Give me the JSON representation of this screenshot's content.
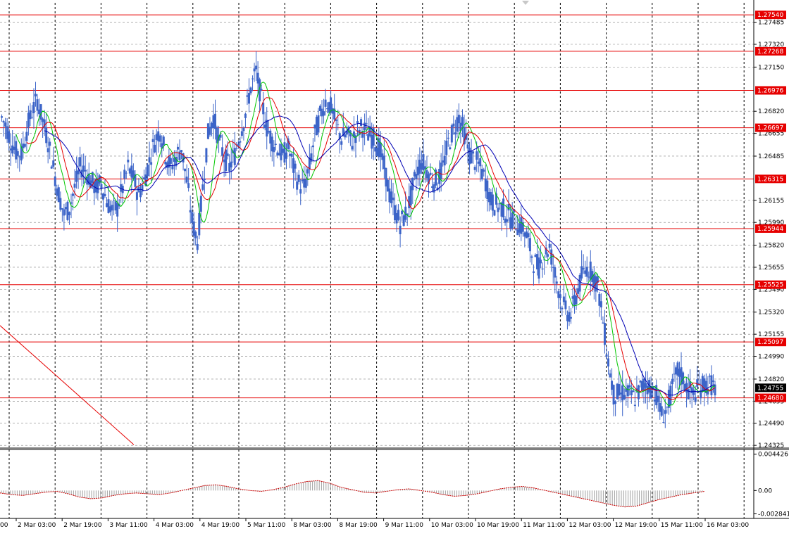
{
  "chart_data": {
    "type": "candlestick",
    "instrument_note": "",
    "y_axis": {
      "ylim": [
        1.2431,
        1.2763
      ],
      "tick_labels": [
        "1.27485",
        "1.27320",
        "1.27150",
        "1.26820",
        "1.26655",
        "1.26485",
        "1.26155",
        "1.25990",
        "1.25820",
        "1.25655",
        "1.25490",
        "1.25320",
        "1.25155",
        "1.24990",
        "1.24820",
        "1.24655",
        "1.24490",
        "1.24325"
      ],
      "tick_values": [
        1.27485,
        1.2732,
        1.2715,
        1.2682,
        1.26655,
        1.26485,
        1.26155,
        1.2599,
        1.2582,
        1.25655,
        1.2549,
        1.2532,
        1.25155,
        1.2499,
        1.2482,
        1.24655,
        1.2449,
        1.24325
      ]
    },
    "x_axis": {
      "tick_labels": [
        "2 Mar 03:00",
        "2 Mar 19:00",
        "3 Mar 11:00",
        "4 Mar 03:00",
        "4 Mar 19:00",
        "5 Mar 11:00",
        "8 Mar 03:00",
        "8 Mar 19:00",
        "9 Mar 11:00",
        "10 Mar 03:00",
        "10 Mar 19:00",
        "11 Mar 11:00",
        "12 Mar 03:00",
        "12 Mar 19:00",
        "15 Mar 11:00",
        "16 Mar 03:00"
      ],
      "left_edge_label": "00"
    },
    "horizontal_levels": [
      {
        "value": 1.2754,
        "label": "1.27540"
      },
      {
        "value": 1.27268,
        "label": "1.27268"
      },
      {
        "value": 1.26976,
        "label": "1.26976"
      },
      {
        "value": 1.26697,
        "label": "1.26697"
      },
      {
        "value": 1.26315,
        "label": "1.26315"
      },
      {
        "value": 1.25944,
        "label": "1.25944"
      },
      {
        "value": 1.25525,
        "label": "1.25525"
      },
      {
        "value": 1.25097,
        "label": "1.25097"
      },
      {
        "value": 1.2468,
        "label": "1.24680"
      }
    ],
    "current_price": {
      "value": 1.24755,
      "label": "1.24755"
    },
    "trend_line": {
      "from_value": 1.2522,
      "to_value": 1.2433
    },
    "price_path": [
      1.268,
      1.2672,
      1.266,
      1.2652,
      1.265,
      1.2668,
      1.2682,
      1.269,
      1.2675,
      1.266,
      1.264,
      1.262,
      1.2605,
      1.261,
      1.2625,
      1.264,
      1.2638,
      1.263,
      1.2625,
      1.2628,
      1.2615,
      1.2608,
      1.261,
      1.2625,
      1.264,
      1.2632,
      1.262,
      1.263,
      1.2645,
      1.266,
      1.2668,
      1.265,
      1.264,
      1.2648,
      1.2655,
      1.263,
      1.26,
      1.2585,
      1.2625,
      1.2665,
      1.2678,
      1.266,
      1.2648,
      1.264,
      1.265,
      1.2665,
      1.268,
      1.27,
      1.2712,
      1.269,
      1.267,
      1.266,
      1.2655,
      1.2648,
      1.2655,
      1.264,
      1.2628,
      1.2625,
      1.264,
      1.2665,
      1.2678,
      1.269,
      1.2685,
      1.2672,
      1.2662,
      1.2665,
      1.266,
      1.2668,
      1.267,
      1.2665,
      1.2662,
      1.2655,
      1.264,
      1.262,
      1.2608,
      1.2598,
      1.2605,
      1.2618,
      1.2635,
      1.2645,
      1.2638,
      1.263,
      1.263,
      1.264,
      1.2658,
      1.2668,
      1.2678,
      1.2665,
      1.265,
      1.2645,
      1.264,
      1.263,
      1.2615,
      1.2612,
      1.261,
      1.2605,
      1.2602,
      1.2598,
      1.2595,
      1.2585,
      1.257,
      1.2565,
      1.2575,
      1.258,
      1.256,
      1.2545,
      1.2532,
      1.253,
      1.2545,
      1.2558,
      1.2565,
      1.2562,
      1.2552,
      1.2525,
      1.2495,
      1.247,
      1.247,
      1.2472,
      1.247,
      1.2468,
      1.2475,
      1.2478,
      1.2476,
      1.247,
      1.2455,
      1.246,
      1.2475,
      1.2488,
      1.2482,
      1.2474,
      1.247,
      1.2476,
      1.2478,
      1.2478,
      1.24755
    ],
    "oscillator": {
      "tick_labels": [
        "0.004426",
        "0.00",
        "-0.002841"
      ],
      "tick_values": [
        0.004426,
        0,
        -0.002841
      ],
      "ylim": [
        -0.0034,
        0.005
      ],
      "signal_path": [
        -0.0003,
        -0.0005,
        -0.0006,
        -0.0004,
        -0.0002,
        -0.0001,
        -0.0004,
        -0.0008,
        -0.001,
        -0.0009,
        -0.0006,
        -0.0004,
        -0.0003,
        -0.0004,
        -0.0005,
        -0.0003,
        0.0,
        0.0003,
        0.0006,
        0.0007,
        0.0005,
        0.0002,
        0.0,
        -0.0001,
        0.0001,
        0.0004,
        0.0008,
        0.0011,
        0.0012,
        0.0009,
        0.0004,
        0.0001,
        -0.0002,
        -0.0003,
        -0.0001,
        0.0001,
        0.0002,
        0.0,
        -0.0002,
        -0.0005,
        -0.0007,
        -0.0006,
        -0.0004,
        -0.0001,
        0.0002,
        0.0004,
        0.0005,
        0.0003,
        0.0,
        -0.0003,
        -0.0006,
        -0.0009,
        -0.0012,
        -0.0015,
        -0.0018,
        -0.002,
        -0.0019,
        -0.0015,
        -0.0011,
        -0.0008,
        -0.0005,
        -0.0003,
        -0.0001
      ]
    },
    "series": [],
    "colors": {
      "candle": "#3c64c8",
      "level": "#e60000",
      "ma_fast": "#00c800",
      "ma_mid": "#e60000",
      "ma_slow": "#0000b4",
      "grid": "#808080",
      "price_tag": "#000000",
      "oscillator_signal": "#c80000",
      "oscillator_hist": "#a0a0a0"
    }
  }
}
